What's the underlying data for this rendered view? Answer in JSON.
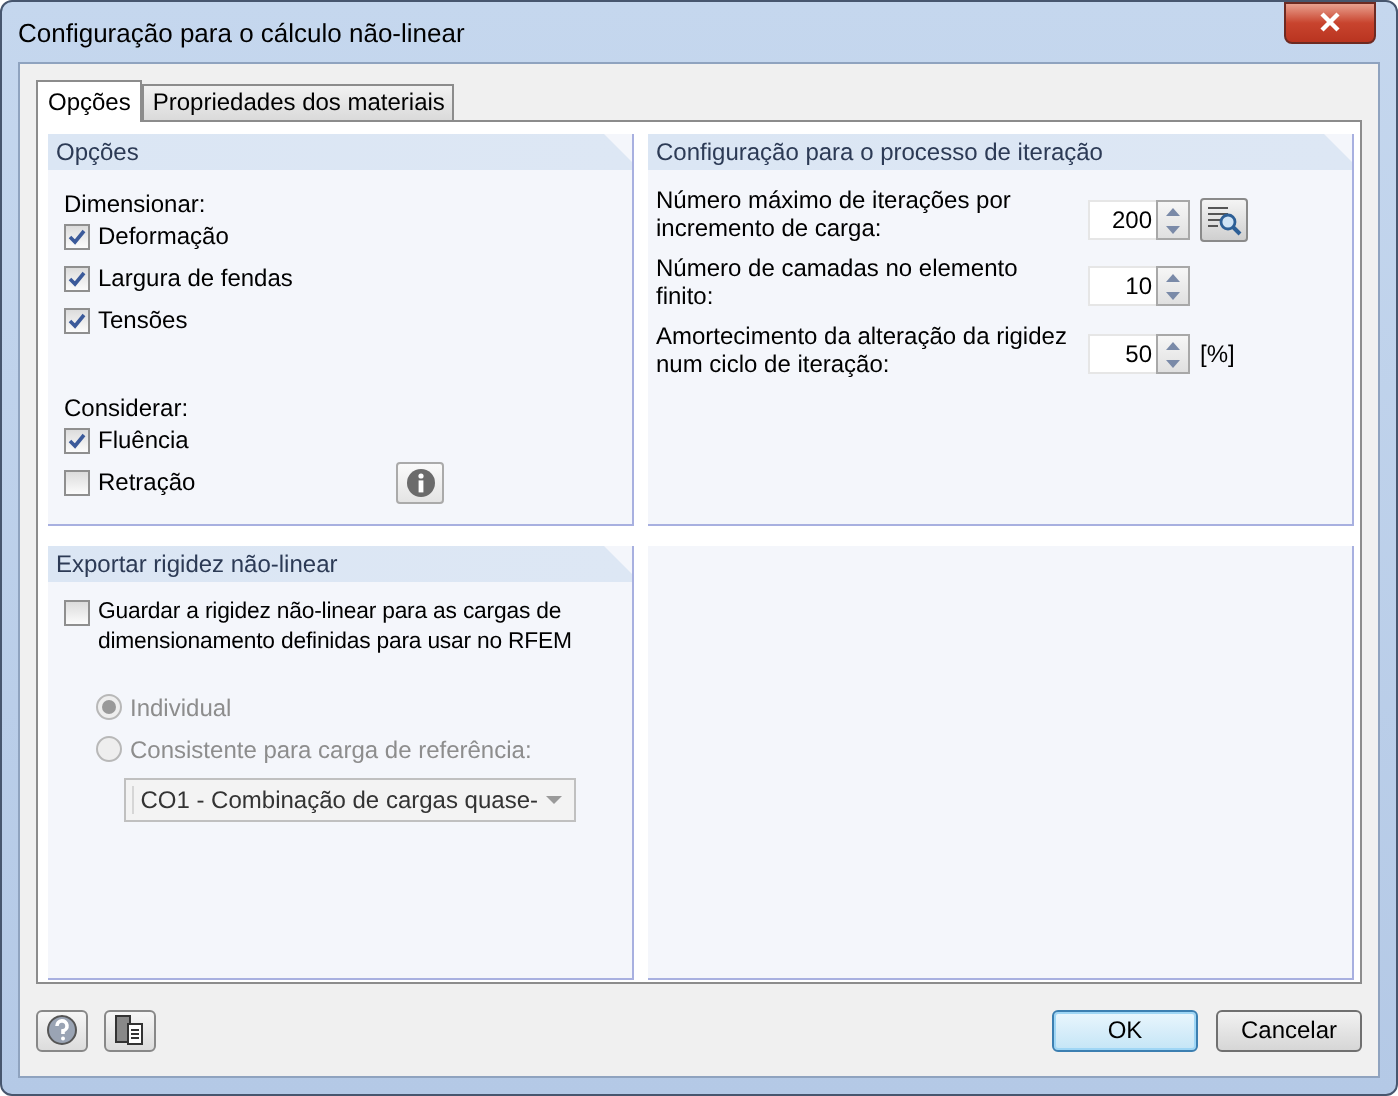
{
  "window": {
    "title": "Configuração para o cálculo não-linear"
  },
  "tabs": [
    {
      "label": "Opções",
      "selected": true
    },
    {
      "label": "Propriedades dos materiais",
      "selected": false
    }
  ],
  "options_panel": {
    "title": "Opções",
    "groups": [
      {
        "label": "Dimensionar:",
        "items": [
          {
            "label": "Deformação",
            "checked": true
          },
          {
            "label": "Largura de fendas",
            "checked": true
          },
          {
            "label": "Tensões",
            "checked": true
          }
        ]
      },
      {
        "label": "Considerar:",
        "items": [
          {
            "label": "Fluência",
            "checked": true
          },
          {
            "label": "Retração",
            "checked": false
          }
        ]
      }
    ]
  },
  "iteration_panel": {
    "title": "Configuração para o processo de iteração",
    "fields": [
      {
        "label": "Número máximo de iterações por incremento de carga:",
        "value": "200",
        "browse": true
      },
      {
        "label": "Número de camadas no elemento finito:",
        "value": "10",
        "browse": false
      },
      {
        "label": "Amortecimento da alteração da rigidez num ciclo de iteração:",
        "value": "50",
        "unit": "[%]",
        "browse": false
      }
    ]
  },
  "export_panel": {
    "title": "Exportar rigidez não-linear",
    "checkbox": {
      "label": "Guardar a rigidez não-linear para as cargas de dimensionamento definidas para usar no RFEM",
      "checked": false
    },
    "radios": [
      {
        "label": "Individual",
        "selected": true,
        "disabled": true
      },
      {
        "label": "Consistente para carga de referência:",
        "selected": false,
        "disabled": true
      }
    ],
    "dropdown": {
      "value": "CO1 - Combinação de cargas quase-",
      "disabled": true
    }
  },
  "buttons": [
    {
      "label": "OK",
      "default": true
    },
    {
      "label": "Cancelar",
      "default": false
    }
  ]
}
